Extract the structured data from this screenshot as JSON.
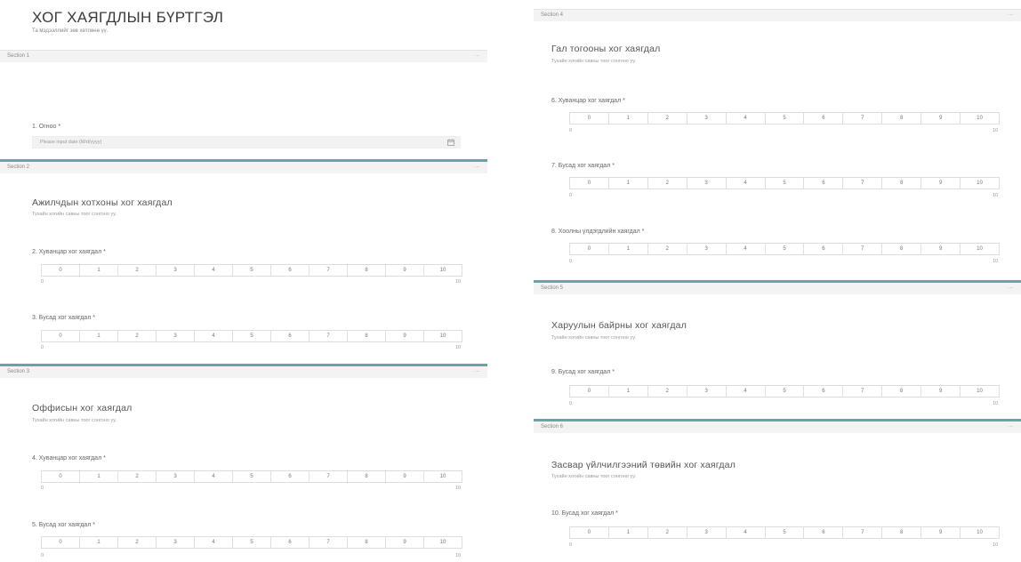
{
  "form": {
    "title": "ХОГ ХАЯГДЛЫН БҮРТГЭЛ",
    "subtitle": "Та мэдээллийг зөв хөтлөнө үү."
  },
  "common": {
    "more_glyph": "…",
    "scale_options": [
      "0",
      "1",
      "2",
      "3",
      "4",
      "5",
      "6",
      "7",
      "8",
      "9",
      "10"
    ],
    "scale_min": "0",
    "scale_max": "10"
  },
  "sections": [
    {
      "label": "Section 1"
    },
    {
      "label": "Section 2",
      "heading": "Ажилчдын хотхоны хог хаягдал",
      "description": "Тухайн хогийн савны тоог сонгоно уу."
    },
    {
      "label": "Section 3",
      "heading": "Оффисын хог хаягдал",
      "description": "Тухайн хогийн савны тоог сонгоно уу."
    },
    {
      "label": "Section 4",
      "heading": "Гал тогооны хог хаягдал",
      "description": "Тухайн хогийн савны тоог сонгоно уу."
    },
    {
      "label": "Section 5",
      "heading": "Харуулын байрны хог хаягдал",
      "description": "Тухайн хогийн савны тоог сонгоно уу."
    },
    {
      "label": "Section 6",
      "heading": "Засвар үйлчилгээний төвийн хог хаягдал",
      "description": "Тухайн хогийн савны тоог сонгоно уу."
    }
  ],
  "questions": [
    {
      "title": "1. Огноо *",
      "placeholder": "Please input date (M/d/yyyy)",
      "icon": "calendar-icon"
    },
    {
      "title": "2. Хуванцар хог хаягдал *"
    },
    {
      "title": "3. Бусад хог хаягдал *"
    },
    {
      "title": "4. Хуванцар хог хаягдал *"
    },
    {
      "title": "5. Бусад хог хаягдал *"
    },
    {
      "title": "6. Хуванцар хог хаягдал *"
    },
    {
      "title": "7. Бусад хог хаягдал *"
    },
    {
      "title": "8. Хоолны үлдэгдлийн хаягдал *"
    },
    {
      "title": "9. Бусад хог хаягдал *"
    },
    {
      "title": "10. Бусад хог хаягдал *"
    }
  ]
}
